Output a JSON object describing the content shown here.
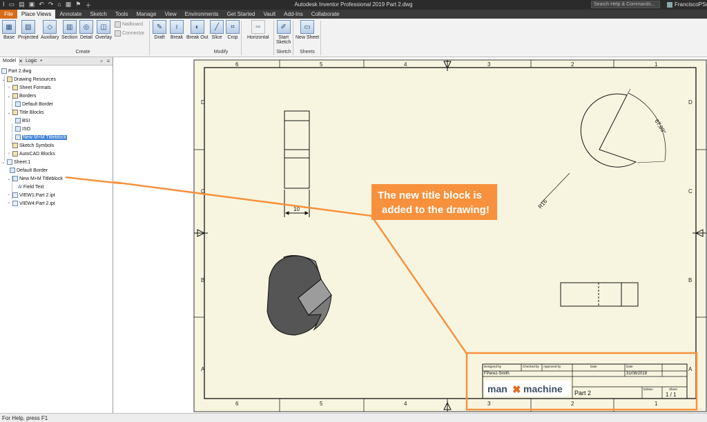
{
  "window": {
    "title": "Autodesk Inventor Professional 2019   Part 2.dwg"
  },
  "search": {
    "placeholder": "Search Help & Commands..."
  },
  "user": {
    "name": "FranciscoPSm"
  },
  "ribbon_tabs": [
    "File",
    "Place Views",
    "Annotate",
    "Sketch",
    "Tools",
    "Manage",
    "View",
    "Environments",
    "Get Started",
    "Vault",
    "Add-Ins",
    "Collaborate"
  ],
  "ribbon": {
    "create": {
      "base": "Base",
      "projected": "Projected",
      "auxiliary": "Auxiliary",
      "section": "Section",
      "detail": "Detail",
      "overlay": "Overlay",
      "nailboard": "Nailboard",
      "connector": "Connector",
      "group": "Create"
    },
    "modify": {
      "draft": "Draft",
      "break": "Break",
      "break_out": "Break Out",
      "slice": "Slice",
      "crop": "Crop",
      "group": "Modify"
    },
    "align": {
      "horizontal": "Horizontal"
    },
    "sketch": {
      "start_1": "Start",
      "start_2": "Sketch",
      "group": "Sketch"
    },
    "sheets": {
      "new_sheet": "New Sheet",
      "group": "Sheets"
    }
  },
  "browser": {
    "tabs": [
      "Model",
      "Logic"
    ],
    "tree": {
      "root": "Part 2.dwg",
      "drawing_resources": "Drawing Resources",
      "sheet_formats": "Sheet Formats",
      "borders": "Borders",
      "default_border": "Default Border",
      "title_blocks": "Title Blocks",
      "bsi": "BSI",
      "iso": "ISO",
      "new_titleblock": "New M+M Titleblock",
      "sketch_symbols": "Sketch Symbols",
      "autocad_blocks": "AutoCAD Blocks",
      "sheet": "Sheet:1",
      "sheet_border": "Default Border",
      "sheet_titleblock": "New M+M Titleblock",
      "field_text": "Field Text",
      "view1": "VIEW1:Part 2.ipt",
      "view4": "VIEW4:Part 2.ipt"
    }
  },
  "drawing": {
    "zone_cols": [
      "6",
      "5",
      "4",
      "3",
      "2",
      "1"
    ],
    "zone_rows": [
      "D",
      "C",
      "B",
      "A"
    ],
    "dim_width": "10",
    "dim_radius": "R16",
    "dim_angle": "67,89°",
    "callout": [
      "The new title block is",
      "added to the drawing!"
    ],
    "callout_color": "#f7913d",
    "title_block": {
      "designed_by_label": "Designed by",
      "checked_by_label": "Checked by",
      "approved_by_label": "Approved by",
      "date_label_1": "Date",
      "date_label_2": "Date",
      "designer": "FPerez-Smith",
      "date": "31/08/2018",
      "logo_left": "man",
      "logo_right": "machine",
      "part_name": "Part 2",
      "edition_label": "Edition",
      "sheet_label": "Sheet",
      "sheet_value": "1 / 1"
    }
  },
  "status": {
    "text": "For Help, press F1"
  }
}
